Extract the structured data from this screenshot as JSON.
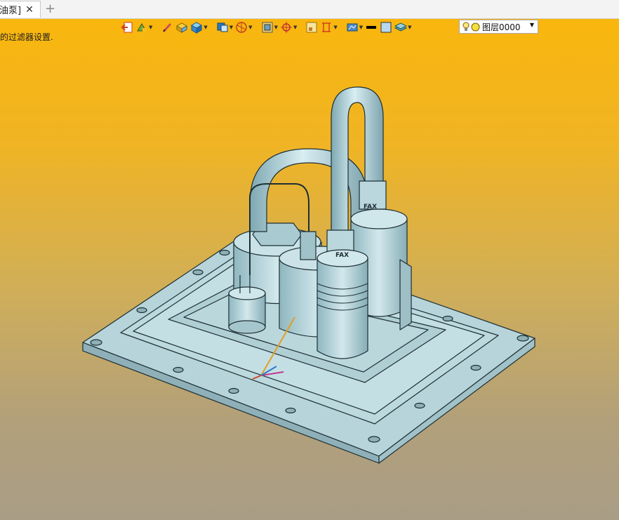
{
  "tabs": [
    {
      "label": "油泵]"
    }
  ],
  "status_message": "的过滤器设置.",
  "layer": {
    "name": "图层0000"
  },
  "colors": {
    "background_top": "#f9b60d",
    "background_bottom": "#a99d86",
    "model_fill": "#b2d3da",
    "model_edge": "#1d2f34"
  },
  "model": {
    "brand_marks": [
      "FAX",
      "FAX"
    ]
  },
  "toolbar_icons": [
    "exit-sketch-icon",
    "layer-paint-icon",
    "pencil-icon",
    "shaded-block-icon",
    "cube-icon",
    "view-cube-icon",
    "section-view-icon",
    "render-mode-icon",
    "origin-icon",
    "frame-icon",
    "align-icon",
    "display-mode-icon",
    "line-color-icon",
    "face-color-icon",
    "layer-stack-icon"
  ]
}
